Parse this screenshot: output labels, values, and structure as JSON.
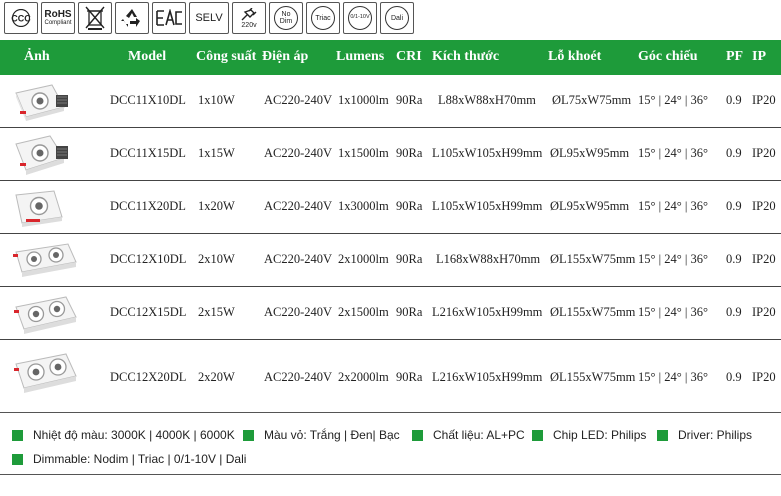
{
  "certifications": [
    {
      "name": "ccc-badge",
      "label": "CCC"
    },
    {
      "name": "rohs-badge",
      "label": "RoHS",
      "sub": "Compliant"
    },
    {
      "name": "weee-badge",
      "label": ""
    },
    {
      "name": "recycle-badge",
      "label": ""
    },
    {
      "name": "eac-badge",
      "label": "EAC"
    },
    {
      "name": "selv-badge",
      "label": "SELV"
    },
    {
      "name": "voltage-badge",
      "label": "220v"
    },
    {
      "name": "no-dim-badge",
      "label": "No Dim"
    },
    {
      "name": "triac-badge",
      "label": "Triac"
    },
    {
      "name": "dim-0-10v-badge",
      "label": "0/1-10V"
    },
    {
      "name": "dali-badge",
      "label": "Dali"
    }
  ],
  "table": {
    "headers": {
      "image": "Ảnh",
      "model": "Model",
      "power": "Công suất",
      "voltage": "Điện áp",
      "lumens": "Lumens",
      "cri": "CRI",
      "size": "Kích thước",
      "cutout": "Lỗ khoét",
      "beam": "Góc chiếu",
      "pf": "PF",
      "ip": "IP"
    },
    "rows": [
      {
        "model": "DCC11X10DL",
        "power": "1x10W",
        "voltage": "AC220-240V",
        "lumens": "1x1000lm",
        "cri": "90Ra",
        "size": "L88xW88xH70mm",
        "cutout": "ØL75xW75mm",
        "beam": "15° | 24° | 36°",
        "pf": "0.9",
        "ip": "IP20"
      },
      {
        "model": "DCC11X15DL",
        "power": "1x15W",
        "voltage": "AC220-240V",
        "lumens": "1x1500lm",
        "cri": "90Ra",
        "size": "L105xW105xH99mm",
        "cutout": "ØL95xW95mm",
        "beam": "15° | 24° | 36°",
        "pf": "0.9",
        "ip": "IP20"
      },
      {
        "model": "DCC11X20DL",
        "power": "1x20W",
        "voltage": "AC220-240V",
        "lumens": "1x3000lm",
        "cri": "90Ra",
        "size": "L105xW105xH99mm",
        "cutout": "ØL95xW95mm",
        "beam": "15° | 24° | 36°",
        "pf": "0.9",
        "ip": "IP20"
      },
      {
        "model": "DCC12X10DL",
        "power": "2x10W",
        "voltage": "AC220-240V",
        "lumens": "2x1000lm",
        "cri": "90Ra",
        "size": "L168xW88xH70mm",
        "cutout": "ØL155xW75mm",
        "beam": "15° | 24° | 36°",
        "pf": "0.9",
        "ip": "IP20"
      },
      {
        "model": "DCC12X15DL",
        "power": "2x15W",
        "voltage": "AC220-240V",
        "lumens": "2x1500lm",
        "cri": "90Ra",
        "size": "L216xW105xH99mm",
        "cutout": "ØL155xW75mm",
        "beam": "15° | 24° | 36°",
        "pf": "0.9",
        "ip": "IP20"
      },
      {
        "model": "DCC12X20DL",
        "power": "2x20W",
        "voltage": "AC220-240V",
        "lumens": "2x2000lm",
        "cri": "90Ra",
        "size": "L216xW105xH99mm",
        "cutout": "ØL155xW75mm",
        "beam": "15° | 24° | 36°",
        "pf": "0.9",
        "ip": "IP20"
      }
    ]
  },
  "footer": {
    "color_temp": "Nhiệt độ màu: 3000K | 4000K | 6000K",
    "housing_color": "Màu vỏ: Trắng | Đen| Bạc",
    "material": "Chất liệu: AL+PC",
    "chip": "Chip LED: Philips",
    "driver": "Driver: Philips",
    "dimmable": "Dimmable: Nodim | Triac | 0/1-10V | Dali"
  },
  "colors": {
    "accent_green": "#1e9b3a",
    "lamp_accent_red": "#d9262c"
  }
}
